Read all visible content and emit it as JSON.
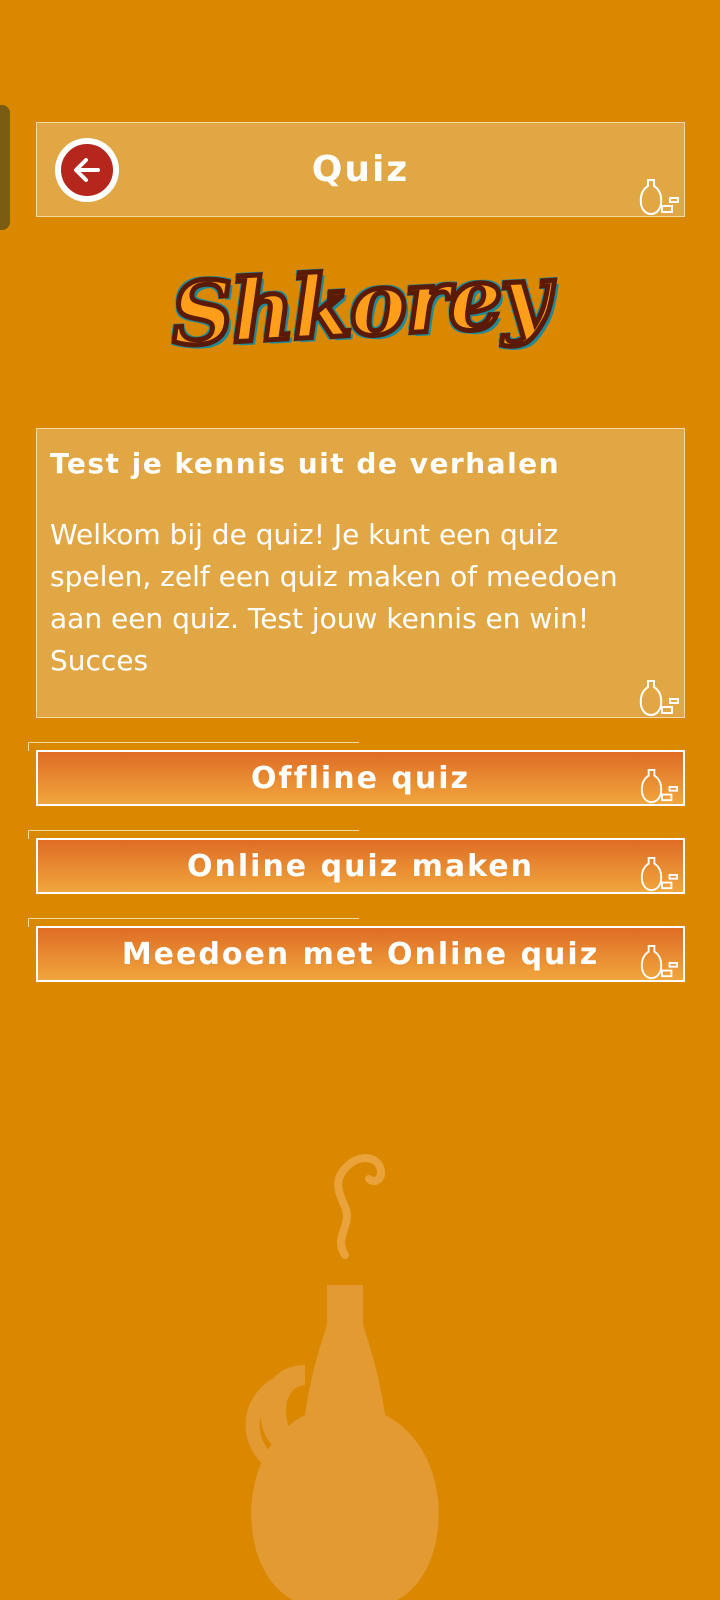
{
  "header": {
    "title": "Quiz",
    "back_icon": "arrow-left-icon"
  },
  "logo": {
    "text": "Shkorey",
    "text_color": "#ff9e1a",
    "outline_color": "#1f8a98"
  },
  "info": {
    "heading": "Test je kennis uit de verhalen",
    "body": "Welkom bij de quiz! Je kunt een quiz spelen, zelf een quiz maken of meedoen aan een quiz. Test jouw kennis en win! Succes"
  },
  "buttons": [
    {
      "label": "Offline quiz"
    },
    {
      "label": "Online quiz maken"
    },
    {
      "label": "Meedoen met Online quiz"
    }
  ],
  "colors": {
    "background": "#d98800",
    "panel": "#e2a745",
    "back_button": "#b5271d",
    "button_gradient_top": "#df6c25",
    "button_gradient_bottom": "#f0a63d"
  }
}
